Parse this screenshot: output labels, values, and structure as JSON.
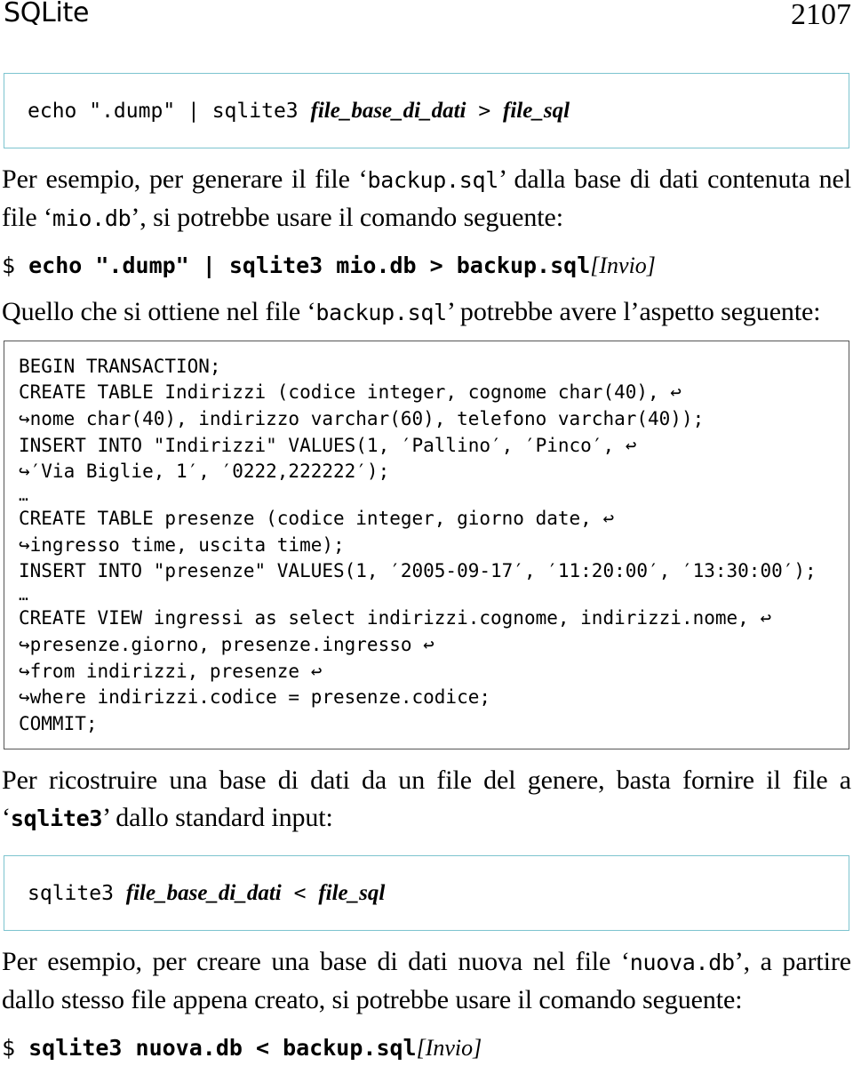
{
  "header": {
    "title": "SQLite",
    "page_number": "2107"
  },
  "syntax_box_1": {
    "text": "echo \".dump\" | sqlite3 ",
    "meta_1": "file_base_di_dati",
    "middle": " > ",
    "meta_2": "file_sql"
  },
  "paragraph_1": {
    "part_1": "Per esempio, per generare il file ‘",
    "code_1": "backup.sql",
    "part_2": "’ dalla base di dati contenuta nel file ‘",
    "code_2": "mio.db",
    "part_3": "’, si potrebbe usare il comando seguente:"
  },
  "command_1": {
    "prompt": "$ ",
    "text": "echo \".dump\" | sqlite3 mio.db > backup.sql",
    "key": "[Invio]"
  },
  "paragraph_2": {
    "part_1": "Quello che si ottiene nel file ‘",
    "code_1": "backup.sql",
    "part_2": "’ potrebbe avere l’aspetto seguente:"
  },
  "listing": {
    "lines": [
      {
        "type": "code",
        "text": "BEGIN TRANSACTION;"
      },
      {
        "type": "code",
        "text": "CREATE TABLE Indirizzi (codice integer, cognome char(40), ↩"
      },
      {
        "type": "code",
        "text": "↪nome char(40), indirizzo varchar(60), telefono varchar(40));"
      },
      {
        "type": "code",
        "text": "INSERT INTO \"Indirizzi\" VALUES(1, ′Pallino′, ′Pinco′, ↩"
      },
      {
        "type": "code",
        "text": "↪′Via Biglie, 1′, ′0222,222222′);"
      },
      {
        "type": "ellipsis",
        "text": "…"
      },
      {
        "type": "code",
        "text": "CREATE TABLE presenze (codice integer, giorno date, ↩"
      },
      {
        "type": "code",
        "text": "↪ingresso time, uscita time);"
      },
      {
        "type": "code",
        "text": "INSERT INTO \"presenze\" VALUES(1, ′2005-09-17′, ′11:20:00′, ′13:30:00′);"
      },
      {
        "type": "ellipsis",
        "text": "…"
      },
      {
        "type": "code",
        "text": "CREATE VIEW ingressi as select indirizzi.cognome, indirizzi.nome, ↩"
      },
      {
        "type": "code",
        "text": "↪presenze.giorno, presenze.ingresso ↩"
      },
      {
        "type": "code",
        "text": "↪from indirizzi, presenze ↩"
      },
      {
        "type": "code",
        "text": "↪where indirizzi.codice = presenze.codice;"
      },
      {
        "type": "code",
        "text": "COMMIT;"
      }
    ]
  },
  "paragraph_3": {
    "part_1": "Per ricostruire una base di dati da un file del genere, basta fornire il file a ‘",
    "code_1": "sqlite3",
    "part_2": "’ dallo standard input:"
  },
  "syntax_box_2": {
    "text": "sqlite3 ",
    "meta_1": "file_base_di_dati",
    "middle": " < ",
    "meta_2": "file_sql"
  },
  "paragraph_4": {
    "part_1": "Per esempio, per creare una base di dati nuova nel file ‘",
    "code_1": "nuova.db",
    "part_2": "’, a partire dallo stesso file appena creato, si potrebbe usare il comando seguente:"
  },
  "command_2": {
    "prompt": "$ ",
    "text": "sqlite3 nuova.db < backup.sql",
    "key": "[Invio]"
  },
  "colors": {
    "syntax_border": "#7dc4cf",
    "listing_border": "#555555",
    "text": "#000000",
    "background": "#ffffff"
  }
}
